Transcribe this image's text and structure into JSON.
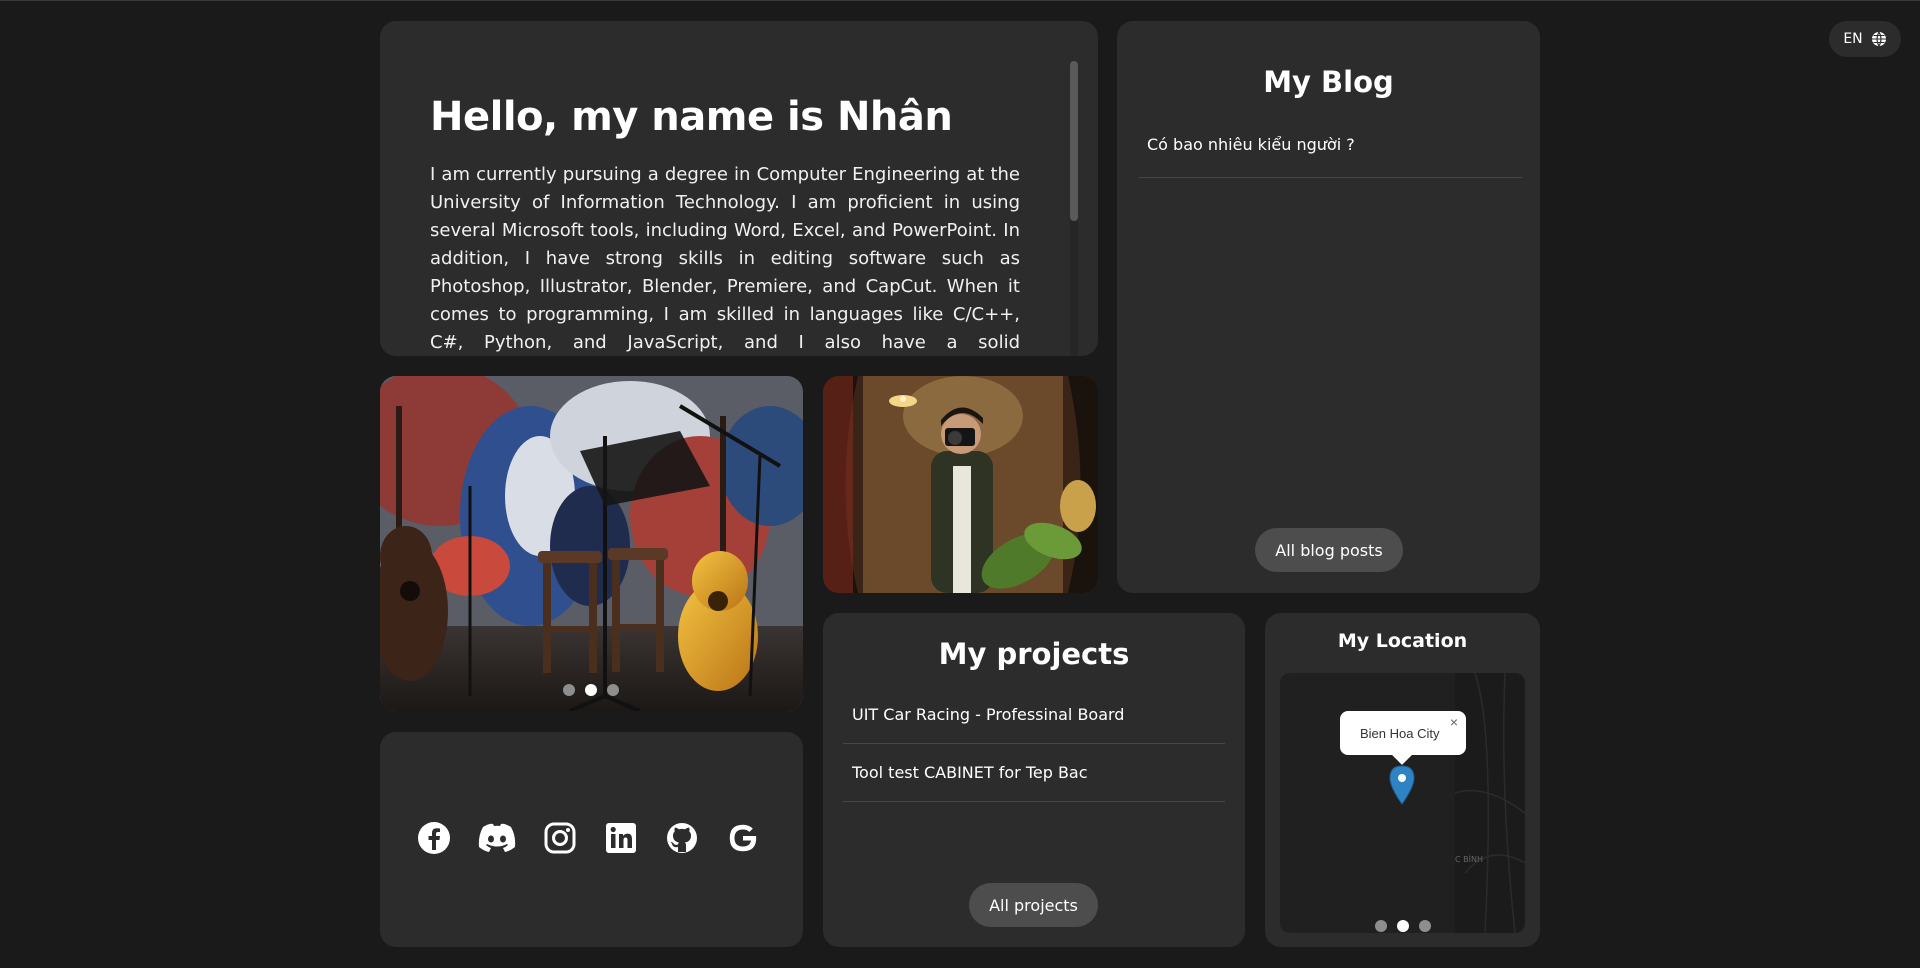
{
  "intro": {
    "title": "Hello, my name is Nhân",
    "body": "I am currently pursuing a degree in Computer Engineering at the University of Information Technology. I am proficient in using several Microsoft tools, including Word, Excel, and PowerPoint. In addition, I have strong skills in editing software such as Photoshop, Illustrator, Blender, Premiere, and CapCut. When it comes to programming, I am skilled in languages like C/C++, C#, Python, and JavaScript, and I also have a solid understanding of web development principles. My"
  },
  "blog": {
    "title": "My Blog",
    "items": [
      "Có bao nhiêu kiểu người ?"
    ],
    "all_label": "All blog posts"
  },
  "photo_carousel": {
    "slide_count": 3,
    "active_index": 1
  },
  "social": {
    "icons": [
      "facebook-icon",
      "discord-icon",
      "instagram-icon",
      "linkedin-icon",
      "github-icon",
      "google-icon"
    ]
  },
  "projects": {
    "title": "My projects",
    "items": [
      "UIT Car Racing - Professinal Board",
      "Tool test CABINET for Tep Bac"
    ],
    "all_label": "All projects"
  },
  "location": {
    "title": "My Location",
    "popup_text": "Bien Hoa City",
    "popup_close": "×",
    "map_label": "C BÌNH",
    "slide_count": 3,
    "active_index": 1
  },
  "lang": {
    "code": "EN",
    "icon": "globe-icon"
  },
  "colors": {
    "background": "#1a1a1a",
    "card": "#2c2c2c",
    "pill": "#4d4d4d",
    "marker": "#2d83c4"
  }
}
